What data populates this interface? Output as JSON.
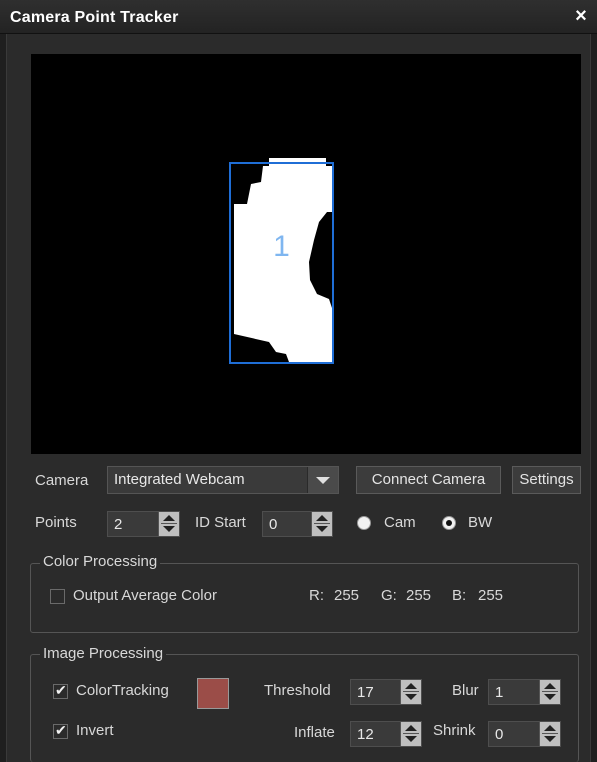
{
  "window": {
    "title": "Camera Point Tracker",
    "close_glyph": "×"
  },
  "preview": {
    "blob_id": "1"
  },
  "camera": {
    "label": "Camera",
    "selected": "Integrated Webcam",
    "connect_label": "Connect Camera",
    "settings_label": "Settings"
  },
  "points": {
    "label": "Points",
    "value": "2",
    "id_start_label": "ID Start",
    "id_start_value": "0",
    "mode_cam_label": "Cam",
    "mode_bw_label": "BW",
    "mode_selected": "BW"
  },
  "color_processing": {
    "title": "Color Processing",
    "output_average_label": "Output Average Color",
    "output_average_checked": false,
    "r_label": "R:",
    "r_value": "255",
    "g_label": "G:",
    "g_value": "255",
    "b_label": "B:",
    "b_value": "255"
  },
  "image_processing": {
    "title": "Image Processing",
    "color_tracking_label": "ColorTracking",
    "color_tracking_checked": true,
    "tracking_color": "#9b4d48",
    "invert_label": "Invert",
    "invert_checked": true,
    "threshold_label": "Threshold",
    "threshold_value": "17",
    "blur_label": "Blur",
    "blur_value": "1",
    "inflate_label": "Inflate",
    "inflate_value": "12",
    "shrink_label": "Shrink",
    "shrink_value": "0"
  }
}
